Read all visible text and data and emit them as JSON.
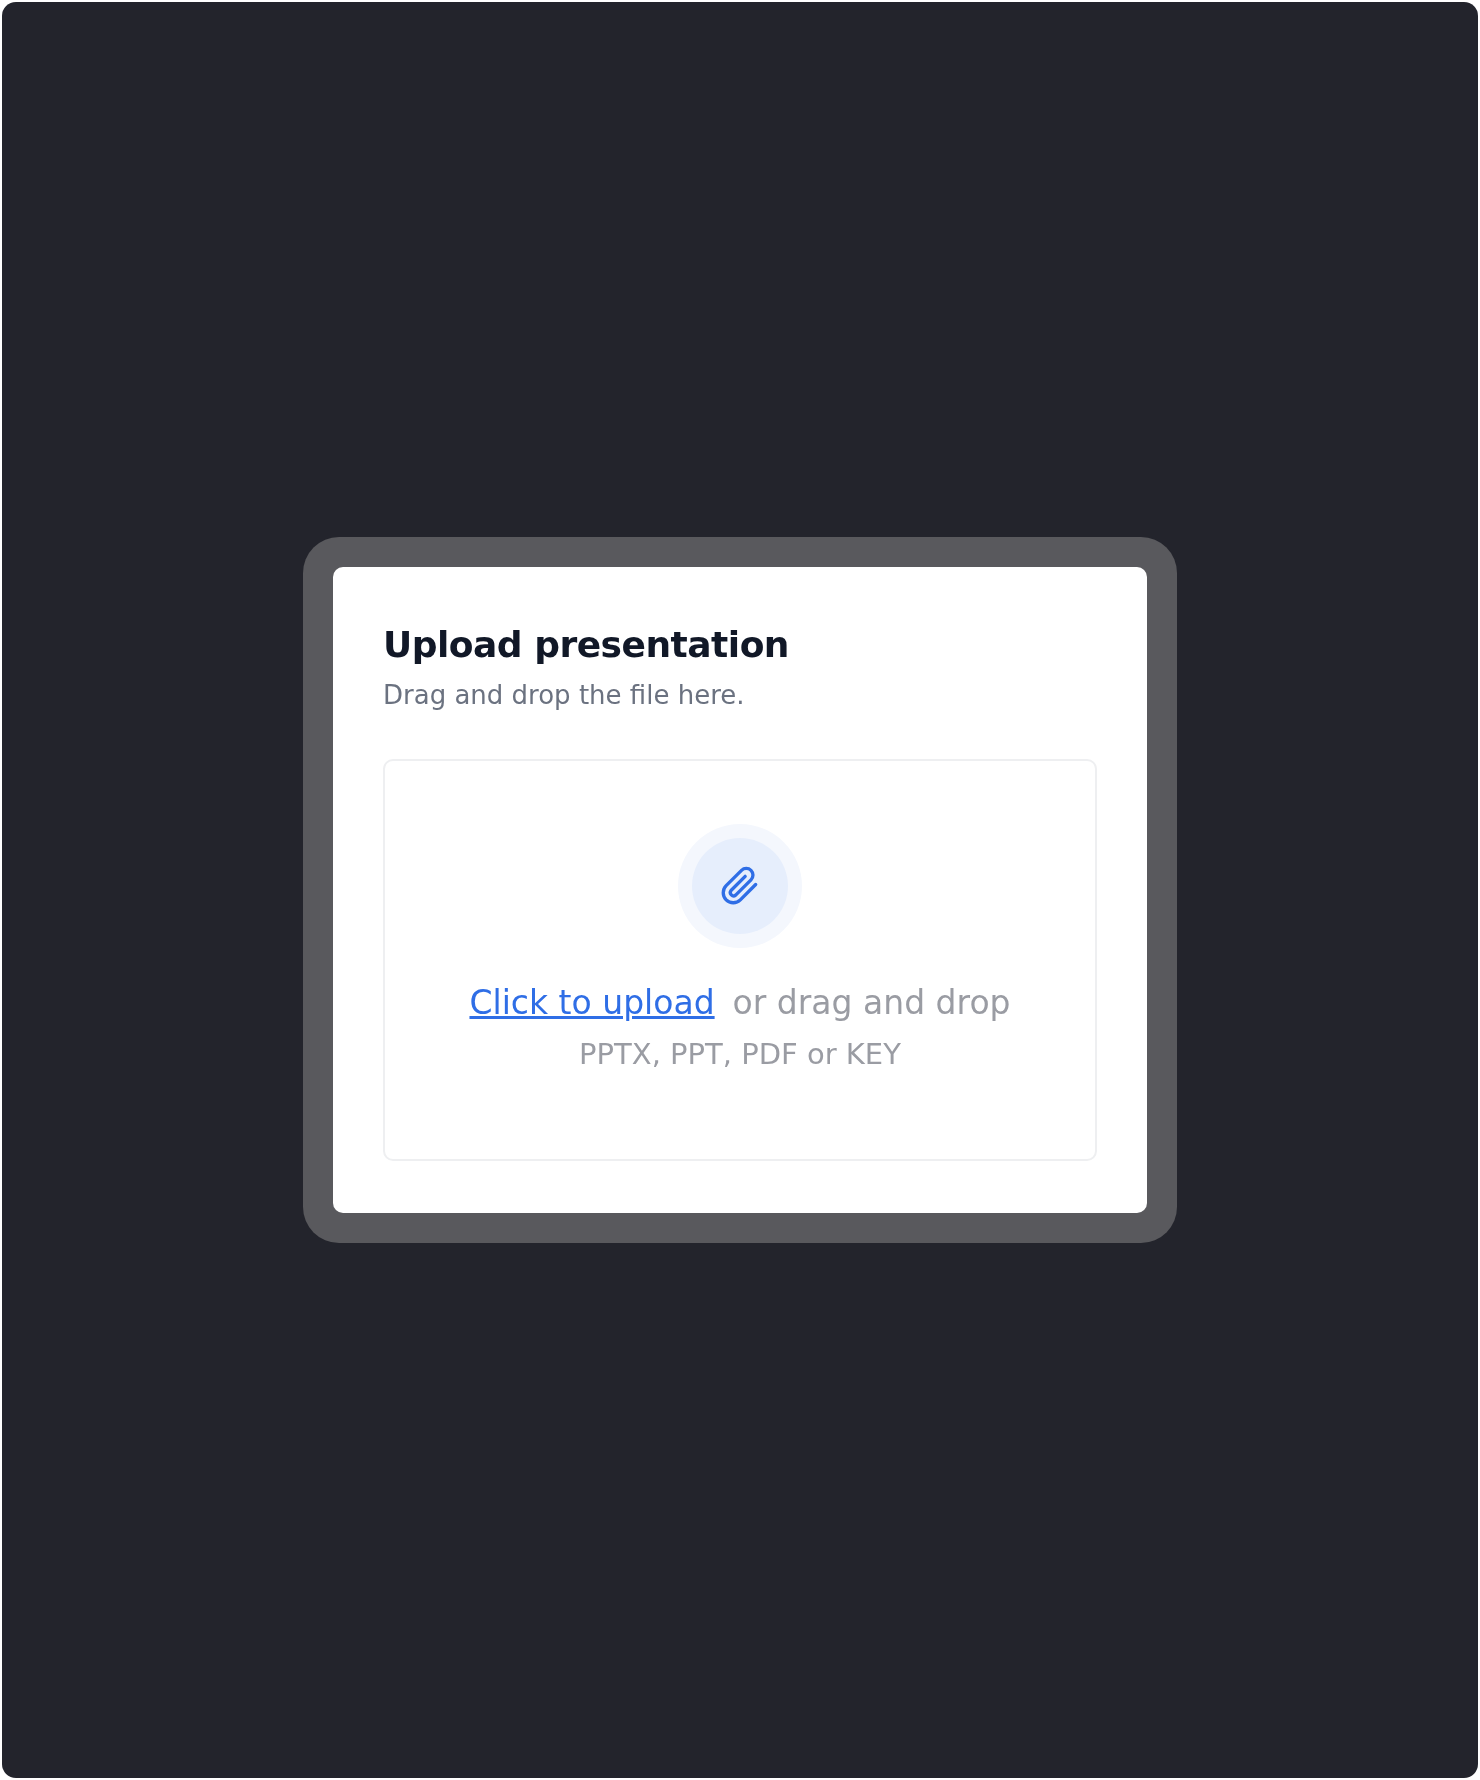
{
  "dialog": {
    "title": "Upload presentation",
    "subtitle": "Drag and drop the file here.",
    "dropzone": {
      "link": "Click to upload",
      "text": "or drag and drop",
      "formats": "PPTX, PPT, PDF or KEY"
    }
  }
}
